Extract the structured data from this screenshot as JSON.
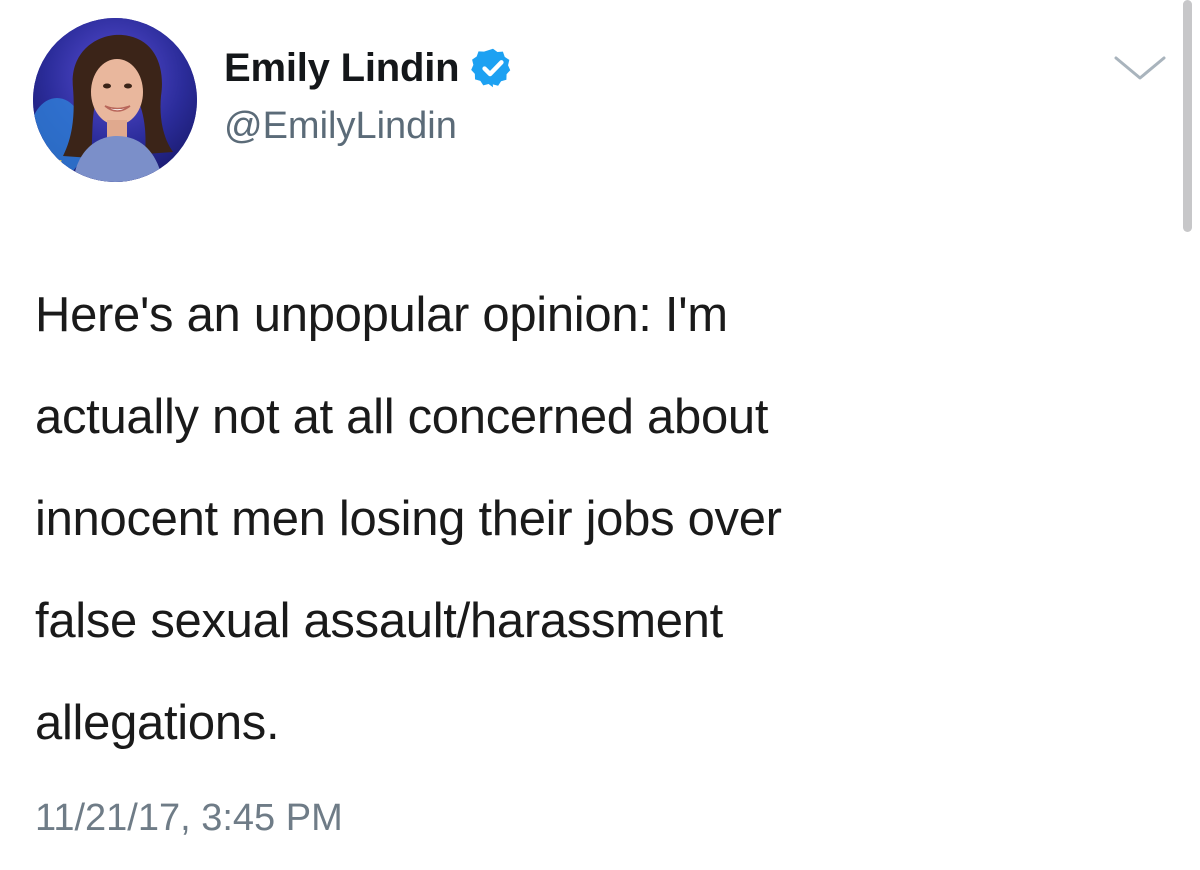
{
  "tweet": {
    "author": {
      "display_name": "Emily Lindin",
      "handle": "@EmilyLindin",
      "verified": true,
      "avatar_icon": "profile-photo"
    },
    "text_lines": [
      "Here's an unpopular opinion: I'm",
      "actually not at all concerned about",
      "innocent men losing their jobs over",
      "false sexual assault/harassment",
      "allegations."
    ],
    "timestamp": "11/21/17, 3:45 PM",
    "menu_icon": "chevron-down-icon"
  },
  "colors": {
    "verified_badge": "#1da1f2",
    "secondary_text": "#657786",
    "primary_text": "#14171a"
  }
}
